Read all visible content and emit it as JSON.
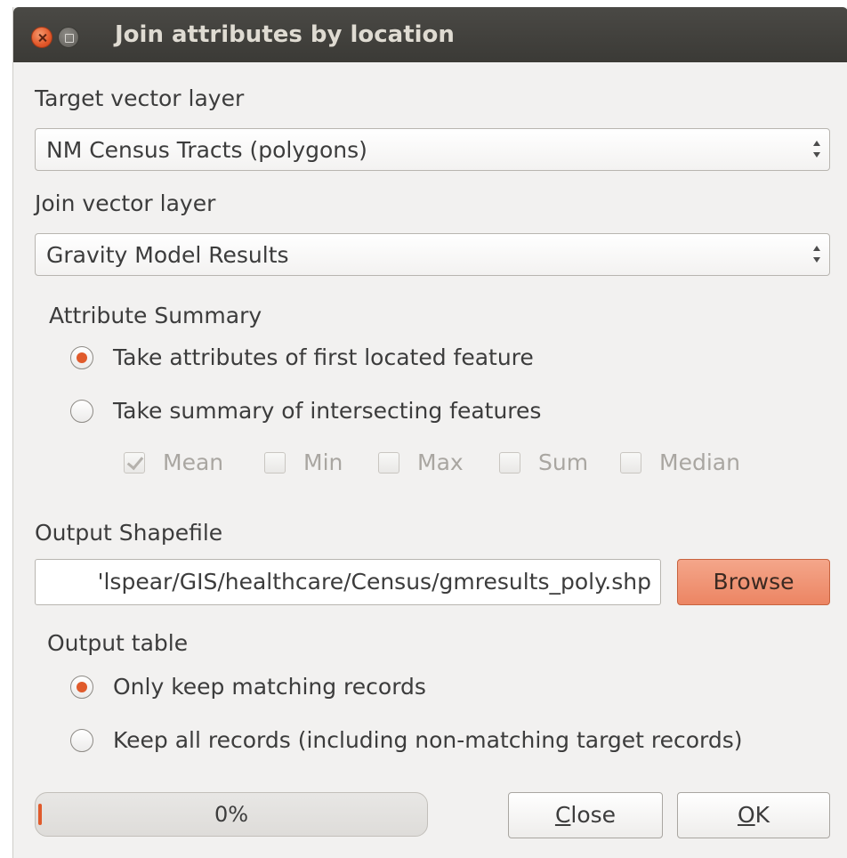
{
  "window": {
    "title": "Join attributes by location"
  },
  "target_layer": {
    "label": "Target vector layer",
    "value": "NM Census Tracts (polygons)"
  },
  "join_layer": {
    "label": "Join vector layer",
    "value": "Gravity Model Results"
  },
  "attribute_summary": {
    "label": "Attribute Summary",
    "options": [
      {
        "label": "Take attributes of first located feature",
        "selected": true
      },
      {
        "label": "Take summary of intersecting features",
        "selected": false
      }
    ],
    "stats": [
      {
        "label": "Mean",
        "checked": true
      },
      {
        "label": "Min",
        "checked": false
      },
      {
        "label": "Max",
        "checked": false
      },
      {
        "label": "Sum",
        "checked": false
      },
      {
        "label": "Median",
        "checked": false
      }
    ]
  },
  "output_shapefile": {
    "label": "Output Shapefile",
    "value": "'lspear/GIS/healthcare/Census/gmresults_poly.shp",
    "browse_label": "Browse"
  },
  "output_table": {
    "label": "Output table",
    "options": [
      {
        "label": "Only keep matching records",
        "selected": true
      },
      {
        "label": "Keep all records (including non-matching target records)",
        "selected": false
      }
    ]
  },
  "progress": {
    "value": 0,
    "text": "0%"
  },
  "buttons": {
    "close": "Close",
    "ok": "OK"
  },
  "colors": {
    "accent": "#e05b2c",
    "titlebar": "#3c3b37",
    "browse": "#ef8f6d"
  }
}
